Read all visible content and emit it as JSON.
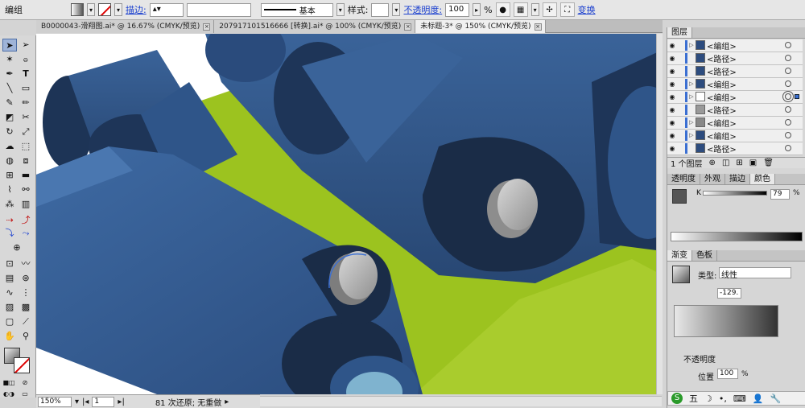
{
  "control_bar": {
    "selection_label": "编组",
    "stroke_label": "描边:",
    "stroke_style": "基本",
    "style_label": "样式:",
    "opacity_label": "不透明度:",
    "opacity_value": "100",
    "opacity_unit": "%",
    "transform_label": "变换"
  },
  "tabs": [
    {
      "label": "B0000043-滑翔图.ai* @ 16.67% (CMYK/预览)",
      "active": false
    },
    {
      "label": "207917101516666 [转换].ai* @ 100% (CMYK/预览)",
      "active": false
    },
    {
      "label": "未标题-3* @ 150% (CMYK/预览)",
      "active": true
    }
  ],
  "tools": [
    "selection-tool",
    "direct-selection-tool",
    "magic-wand-tool",
    "lasso-tool",
    "pen-tool",
    "type-tool",
    "line-tool",
    "rectangle-tool",
    "paintbrush-tool",
    "pencil-tool",
    "eraser-tool",
    "scissors-tool",
    "rotate-tool",
    "scale-tool",
    "warp-tool",
    "free-transform-tool",
    "shape-builder-tool",
    "perspective-tool",
    "mesh-tool",
    "gradient-tool",
    "eyedropper-tool",
    "blend-tool",
    "symbol-sprayer-tool",
    "column-graph-tool",
    "artboard-tool",
    "slice-tool",
    "hand-tool",
    "zoom-tool"
  ],
  "status": {
    "zoom": "150%",
    "page": "1",
    "undo_text": "81 次还原; 无重做"
  },
  "layers_panel": {
    "title": "图层",
    "rows": [
      {
        "name": "<编组>",
        "expandable": true
      },
      {
        "name": "<路径>",
        "expandable": false
      },
      {
        "name": "<路径>",
        "expandable": false
      },
      {
        "name": "<编组>",
        "expandable": true
      },
      {
        "name": "<编组>",
        "expandable": true
      },
      {
        "name": "<路径>",
        "expandable": false
      },
      {
        "name": "<编组>",
        "expandable": true
      },
      {
        "name": "<编组>",
        "expandable": true
      },
      {
        "name": "<路径>",
        "expandable": false
      }
    ],
    "footer": "1 个图层"
  },
  "color_panel": {
    "tabs": [
      "透明度",
      "外观",
      "描边",
      "颜色"
    ],
    "channel": "K",
    "value": "79",
    "unit": "%"
  },
  "gradient_panel": {
    "tabs": [
      "渐变",
      "色板"
    ],
    "type_label": "类型:",
    "type_value": "线性",
    "angle": "-129.",
    "opacity_label": "不透明度",
    "position_label": "位置",
    "position_value": "100",
    "unit": "%"
  },
  "ime_bar": {
    "label": "五"
  },
  "colors": {
    "blue": "#30558a",
    "dark_blue": "#1a2c47",
    "green": "#9cc31f",
    "gray_cap": "#a7a7a7",
    "selection": "#3b6fd2"
  }
}
